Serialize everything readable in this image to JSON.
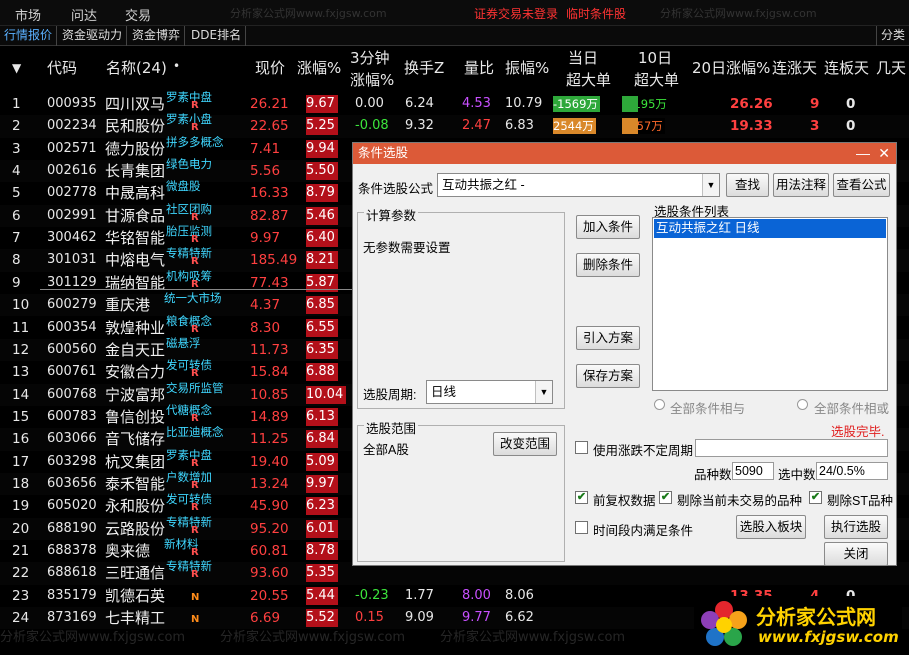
{
  "menu": {
    "items": [
      "市场",
      "问达",
      "交易"
    ],
    "status": "证券交易未登录",
    "status2": "临时条件股",
    "watermark": "分析家公式网www.fxjgsw.com"
  },
  "tabs": [
    "行情报价",
    "资金驱动力",
    "资金博弈",
    "DDE排名"
  ],
  "tab_right": "分类",
  "headers": {
    "code": "代码",
    "name": "名称(24)",
    "price": "现价",
    "chg": "涨幅%",
    "chg3_a": "3分钟",
    "chg3_b": "涨幅%",
    "turnover": "换手Z",
    "vr": "量比",
    "amp": "振幅%",
    "big1_a": "当日",
    "big1_b": "超大单",
    "big10_a": "10日",
    "big10_b": "超大单",
    "chg20": "20日涨幅%",
    "updays": "连涨天",
    "limitdays": "连板天",
    "jitian": "几天"
  },
  "rows": [
    {
      "no": "1",
      "code": "000935",
      "name": "四川双马",
      "tag": "罗素中盘",
      "badge": "R",
      "price": "26.21",
      "chg": "9.67",
      "chg3": "0.00",
      "chg3c": "white",
      "to": "6.24",
      "vr": "4.53",
      "vrc": "purple",
      "amp": "10.79",
      "big1": "-1569万",
      "big1t": "neg",
      "big10": "-1195万",
      "big10t": "neg",
      "chg20": "26.26",
      "up": "9",
      "lim": "0"
    },
    {
      "no": "2",
      "code": "002234",
      "name": "民和股份",
      "tag": "罗素小盘",
      "badge": "R",
      "price": "22.65",
      "chg": "5.25",
      "chg3": "-0.08",
      "chg3c": "green",
      "to": "9.32",
      "vr": "2.47",
      "vrc": "red",
      "amp": "6.83",
      "big1": "2544万",
      "big1t": "pos",
      "big10": "3557万",
      "big10t": "pos",
      "chg20": "19.33",
      "up": "3",
      "lim": "0"
    },
    {
      "no": "3",
      "code": "002571",
      "name": "德力股份",
      "tag": "拼多多概念",
      "badge": "",
      "price": "7.41",
      "chg": "9.94"
    },
    {
      "no": "4",
      "code": "002616",
      "name": "长青集团",
      "tag": "绿色电力",
      "badge": "",
      "price": "5.56",
      "chg": "5.50"
    },
    {
      "no": "5",
      "code": "002778",
      "name": "中晟高科",
      "tag": "微盘股",
      "badge": "",
      "price": "16.33",
      "chg": "8.79"
    },
    {
      "no": "6",
      "code": "002991",
      "name": "甘源食品",
      "tag": "社区团购",
      "badge": "R",
      "price": "82.87",
      "chg": "5.46"
    },
    {
      "no": "7",
      "code": "300462",
      "name": "华铭智能",
      "tag": "胎压监测",
      "badge": "R",
      "price": "9.97",
      "chg": "6.40"
    },
    {
      "no": "8",
      "code": "301031",
      "name": "中熔电气",
      "tag": "专精特新",
      "badge": "R",
      "price": "185.49",
      "chg": "8.21"
    },
    {
      "no": "9",
      "code": "301129",
      "name": "瑞纳智能",
      "tag": "机构吸筹",
      "badge": "R",
      "price": "77.43",
      "chg": "5.87"
    },
    {
      "no": "10",
      "code": "600279",
      "name": "重庆港",
      "tag": "统一大市场",
      "badge": "",
      "price": "4.37",
      "chg": "6.85"
    },
    {
      "no": "11",
      "code": "600354",
      "name": "敦煌种业",
      "tag": "粮食概念",
      "badge": "R",
      "price": "8.30",
      "chg": "6.55"
    },
    {
      "no": "12",
      "code": "600560",
      "name": "金自天正",
      "tag": "磁悬浮",
      "badge": "",
      "price": "11.73",
      "chg": "6.35"
    },
    {
      "no": "13",
      "code": "600761",
      "name": "安徽合力",
      "tag": "发可转债",
      "badge": "R",
      "price": "15.84",
      "chg": "6.88"
    },
    {
      "no": "14",
      "code": "600768",
      "name": "宁波富邦",
      "tag": "交易所监管",
      "badge": "",
      "price": "10.85",
      "chg": "10.04"
    },
    {
      "no": "15",
      "code": "600783",
      "name": "鲁信创投",
      "tag": "代糖概念",
      "badge": "R",
      "price": "14.89",
      "chg": "6.13"
    },
    {
      "no": "16",
      "code": "603066",
      "name": "音飞储存",
      "tag": "比亚迪概念",
      "badge": "",
      "price": "11.25",
      "chg": "6.84"
    },
    {
      "no": "17",
      "code": "603298",
      "name": "杭叉集团",
      "tag": "罗素中盘",
      "badge": "R",
      "price": "19.40",
      "chg": "5.09"
    },
    {
      "no": "18",
      "code": "603656",
      "name": "泰禾智能",
      "tag": "户数增加",
      "badge": "R",
      "price": "13.24",
      "chg": "9.97"
    },
    {
      "no": "19",
      "code": "605020",
      "name": "永和股份",
      "tag": "发可转债",
      "badge": "R",
      "price": "45.90",
      "chg": "6.23"
    },
    {
      "no": "20",
      "code": "688190",
      "name": "云路股份",
      "tag": "专精特新",
      "badge": "R",
      "price": "95.20",
      "chg": "6.01"
    },
    {
      "no": "21",
      "code": "688378",
      "name": "奥来德",
      "tag": "新材料",
      "badge": "R",
      "price": "60.81",
      "chg": "8.78"
    },
    {
      "no": "22",
      "code": "688618",
      "name": "三旺通信",
      "tag": "专精特新",
      "badge": "R",
      "price": "93.60",
      "chg": "5.35"
    },
    {
      "no": "23",
      "code": "835179",
      "name": "凯德石英",
      "tag": "",
      "badge": "N",
      "price": "20.55",
      "chg": "5.44",
      "chg3": "-0.23",
      "chg3c": "green",
      "to": "1.77",
      "vr": "8.00",
      "vrc": "purple",
      "amp": "8.06",
      "chg20": "13.35",
      "up": "4",
      "lim": "0"
    },
    {
      "no": "24",
      "code": "873169",
      "name": "七丰精工",
      "tag": "",
      "badge": "N",
      "price": "6.69",
      "chg": "5.52",
      "chg3": "0.15",
      "chg3c": "red",
      "to": "9.09",
      "vr": "9.77",
      "vrc": "purple",
      "amp": "6.62"
    }
  ],
  "dialog": {
    "title": "条件选股",
    "formula_label": "条件选股公式",
    "formula_value": "互动共振之红 -",
    "btn_find": "查找",
    "btn_usage": "用法注释",
    "btn_view": "查看公式",
    "calc_params": "计算参数",
    "no_params": "无参数需要设置",
    "btn_add": "加入条件",
    "btn_delete": "删除条件",
    "btn_import": "引入方案",
    "btn_save": "保存方案",
    "list_title": "选股条件列表",
    "list_items": [
      "互动共振之红  日线"
    ],
    "period_label": "选股周期:",
    "period_value": "日线",
    "radio_and": "全部条件相与",
    "radio_or": "全部条件相或",
    "done": "选股完毕.",
    "range_title": "选股范围",
    "range_value": "全部A股",
    "btn_range": "改变范围",
    "chk_irregular": "使用涨跌不定周期",
    "stock_count_label": "品种数",
    "stock_count": "5090",
    "selected_label": "选中数",
    "selected": "24/0.5%",
    "chk_fq": "前复权数据",
    "chk_exclude_notrade": "剔除当前未交易的品种",
    "chk_exclude_st": "剔除ST品种",
    "chk_period": "时间段内满足条件",
    "btn_to_block": "选股入板块",
    "btn_run": "执行选股",
    "btn_close": "关闭"
  },
  "logo": {
    "cn": "分析家公式网",
    "url": "www.fxjgsw.com"
  },
  "colors": {
    "up_box": "#b3101a",
    "down_box": "#0a6d10",
    "tag": "#3fd7ff",
    "title_bar": "#dc5a38"
  }
}
